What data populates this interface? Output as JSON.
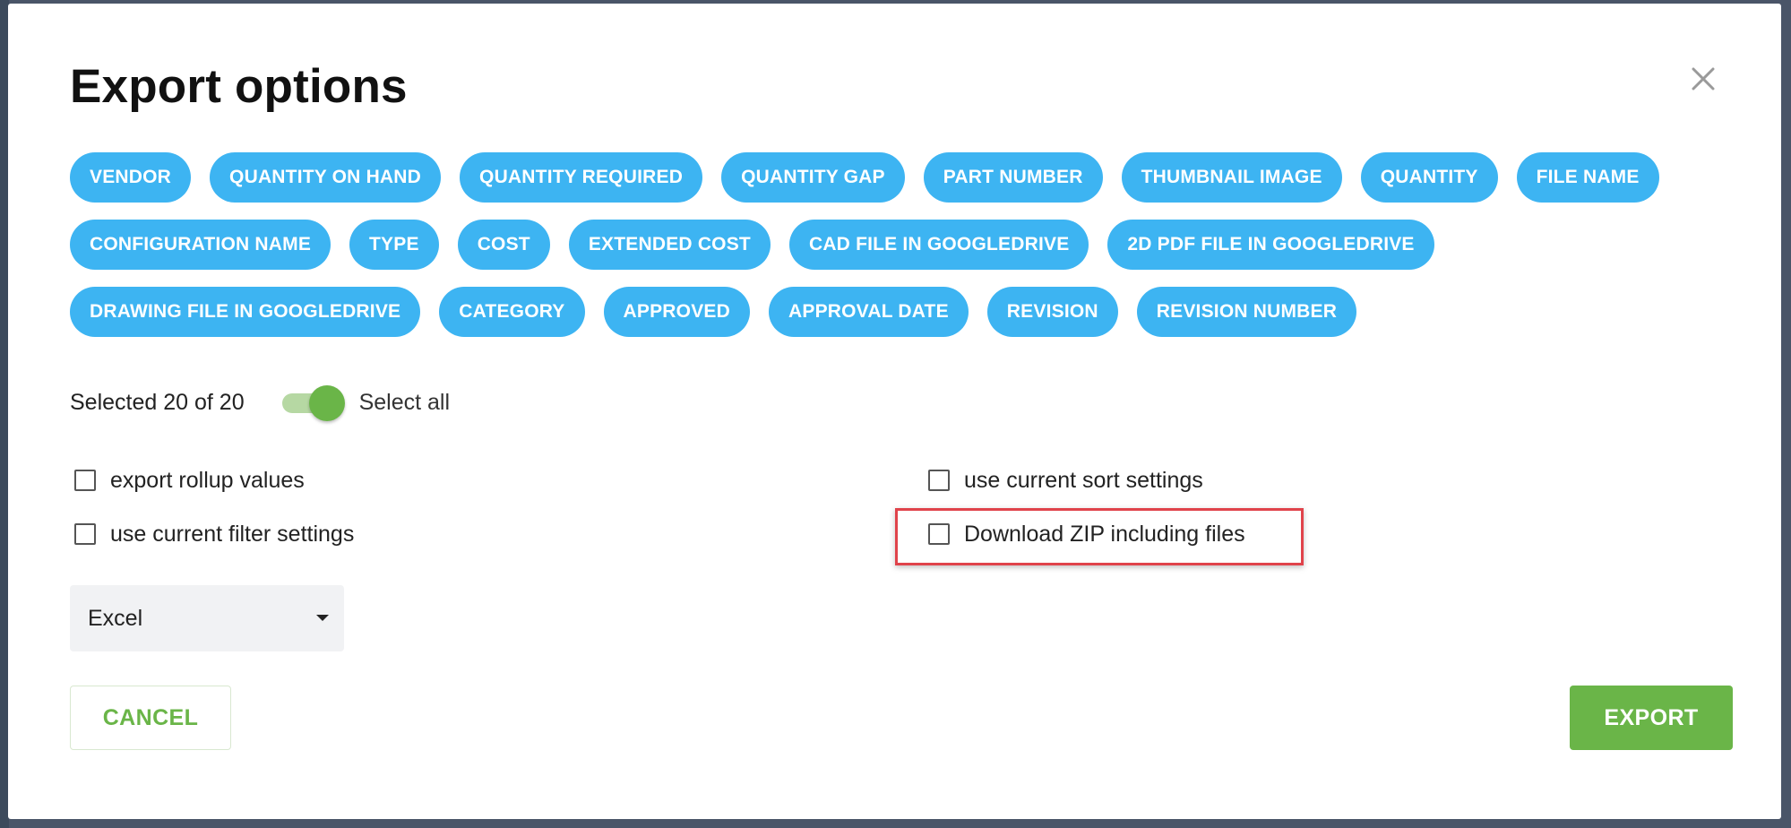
{
  "dialog": {
    "title": "Export options",
    "close_icon": "close-icon"
  },
  "columns": {
    "rows": [
      [
        "VENDOR",
        "QUANTITY ON HAND",
        "QUANTITY REQUIRED",
        "QUANTITY GAP",
        "PART NUMBER",
        "THUMBNAIL IMAGE",
        "QUANTITY",
        "FILE NAME"
      ],
      [
        "CONFIGURATION NAME",
        "TYPE",
        "COST",
        "EXTENDED COST",
        "CAD FILE IN GOOGLEDRIVE",
        "2D PDF FILE IN GOOGLEDRIVE"
      ],
      [
        "DRAWING FILE IN GOOGLEDRIVE",
        "CATEGORY",
        "APPROVED",
        "APPROVAL DATE",
        "REVISION",
        "REVISION NUMBER"
      ]
    ],
    "chip_color": "#3db4f2"
  },
  "selection": {
    "summary": "Selected 20 of 20",
    "select_all_label": "Select all",
    "select_all_on": true
  },
  "options": {
    "export_rollup": {
      "label": "export rollup values",
      "checked": false
    },
    "current_filter": {
      "label": "use current filter settings",
      "checked": false
    },
    "current_sort": {
      "label": "use current sort settings",
      "checked": false
    },
    "download_zip": {
      "label": "Download ZIP including files",
      "checked": false,
      "highlight_color": "#e0434b"
    }
  },
  "format": {
    "selected": "Excel"
  },
  "actions": {
    "cancel_label": "CANCEL",
    "export_label": "EXPORT",
    "accent": "#6ab548"
  }
}
